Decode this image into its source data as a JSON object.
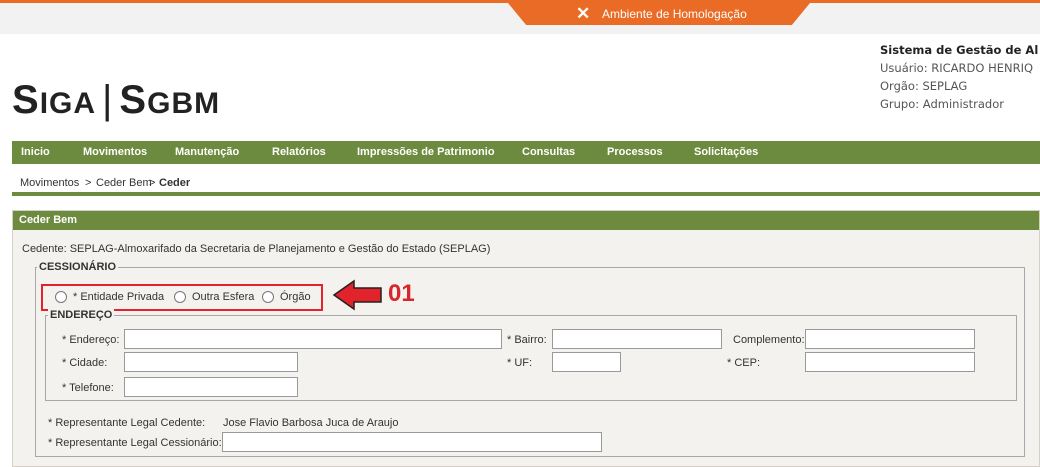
{
  "env": {
    "label": "Ambiente de Homologação",
    "icon": "tools-icon"
  },
  "logo": {
    "s": "S",
    "iga": "IGA",
    "sep": "|",
    "s2": "S",
    "gbm": "GBM"
  },
  "system": {
    "title": "Sistema de Gestão de Al",
    "user": "Usuário: RICARDO HENRIQ",
    "org": "Orgão: SEPLAG",
    "group": "Grupo: Administrador"
  },
  "menu": [
    "Inicio",
    "Movimentos",
    "Manutenção",
    "Relatórios",
    "Impressões de Patrimonio",
    "Consultas",
    "Processos",
    "Solicitações"
  ],
  "breadcrumb": {
    "item1": "Movimentos",
    "sep": ">",
    "item2": "Ceder Bem",
    "current": "Ceder"
  },
  "panel": {
    "title": "Ceder Bem",
    "cedente": "Cedente: SEPLAG-Almoxarifado da Secretaria de Planejamento e Gestão do Estado (SEPLAG)",
    "cessionario_legend": "CESSIONÁRIO",
    "radios": [
      "* Entidade Privada",
      "Outra Esfera",
      "Órgão"
    ],
    "endereco_legend": "ENDEREÇO",
    "fields": {
      "endereco": "* Endereço:",
      "bairro": "* Bairro:",
      "complemento": "Complemento:",
      "cidade": "* Cidade:",
      "uf": "* UF:",
      "cep": "* CEP:",
      "telefone": "* Telefone:"
    },
    "rep_cedente_label": "* Representante Legal Cedente:",
    "rep_cedente_value": "Jose Flavio Barbosa Juca de Araujo",
    "rep_cessionario_label": "* Representante Legal Cessionário:"
  },
  "annotation": {
    "number": "01",
    "color": "#e3232b"
  },
  "colors": {
    "menu_green": "#6d8b3e",
    "orange": "#e96b25",
    "panel_bg": "#f4f2ee"
  }
}
